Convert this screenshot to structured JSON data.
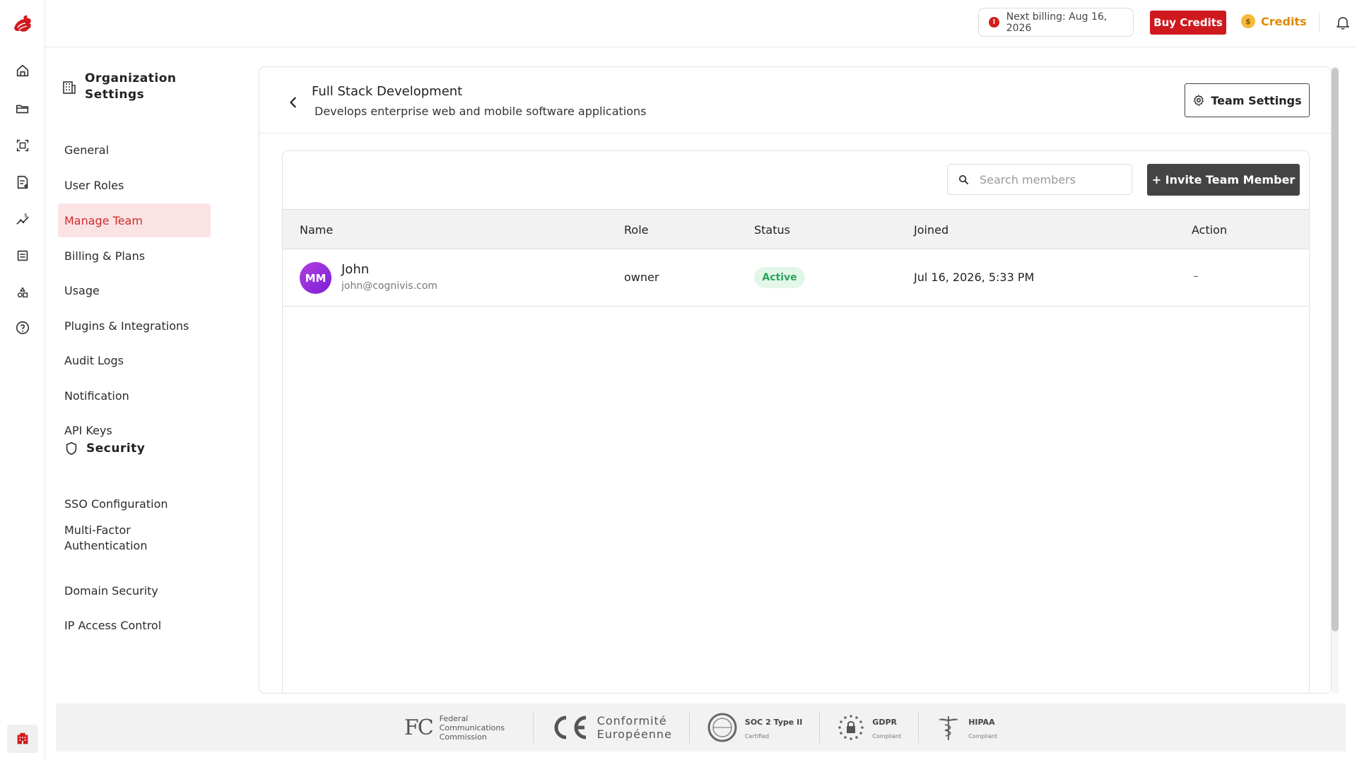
{
  "rail": {
    "icons": [
      "home-icon",
      "folder-icon",
      "scan-icon",
      "document-add-icon",
      "pricing-chart-icon",
      "list-box-icon",
      "shapes-icon",
      "help-circle-icon"
    ],
    "org_icon": "building-icon"
  },
  "topbar": {
    "billing_text": "Next billing: Aug 16, 2026",
    "buy_credits_label": "Buy Credits",
    "credits_label": "Credits",
    "coin_symbol": "$"
  },
  "settings_nav": {
    "title": "Organization Settings",
    "items": [
      {
        "label": "General"
      },
      {
        "label": "User Roles"
      },
      {
        "label": "Manage Team"
      },
      {
        "label": "Billing & Plans"
      },
      {
        "label": "Usage"
      },
      {
        "label": "Plugins & Integrations"
      },
      {
        "label": "Audit Logs"
      },
      {
        "label": "Notification"
      },
      {
        "label": "API Keys"
      }
    ],
    "active_item": "Manage Team",
    "security_title": "Security",
    "security_items": [
      {
        "label": "SSO Configuration"
      },
      {
        "label": "Multi-Factor Authentication"
      },
      {
        "label": "Domain Security"
      },
      {
        "label": "IP Access Control"
      }
    ]
  },
  "team": {
    "name": "Full Stack Development",
    "description": "Develops enterprise web and mobile software applications",
    "settings_button": "Team Settings"
  },
  "members": {
    "search_placeholder": "Search members",
    "invite_label": "+ Invite Team Member",
    "columns": [
      "Name",
      "Role",
      "Status",
      "Joined",
      "Action"
    ],
    "rows": [
      {
        "initials": "MM",
        "name": "John",
        "email": "john@cognivis.com",
        "role": "owner",
        "status": "Active",
        "joined": "Jul 16, 2026, 5:33 PM",
        "action": "–"
      }
    ]
  },
  "compliance": {
    "fcc": "Federal Communications Commission",
    "fcc_mark": "FC",
    "ce_line1": "Conformité",
    "ce_line2": "Européenne",
    "soc_label": "SOC 2 Type II",
    "soc_sub": "Certified",
    "gdpr_label": "GDPR",
    "gdpr_sub": "Compliant",
    "hipaa_label": "HIPAA",
    "hipaa_sub": "Compliant"
  },
  "colors": {
    "brand_red": "#d0191e",
    "active_nav_bg": "#fbe3e3",
    "credits_orange": "#e08a00",
    "status_green": "#2ea45a",
    "invite_button": "#444444"
  }
}
